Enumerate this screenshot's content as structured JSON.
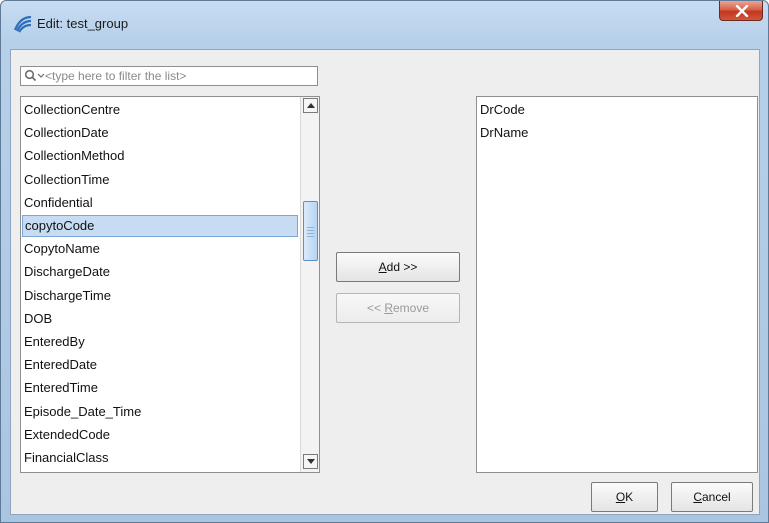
{
  "window": {
    "title": "Edit: test_group"
  },
  "filter": {
    "placeholder": "<type here to filter the list>",
    "value": ""
  },
  "available_list": {
    "items": [
      "CollectionCentre",
      "CollectionDate",
      "CollectionMethod",
      "CollectionTime",
      "Confidential",
      "copytoCode",
      "CopytoName",
      "DischargeDate",
      "DischargeTime",
      "DOB",
      "EnteredBy",
      "EnteredDate",
      "EnteredTime",
      "Episode_Date_Time",
      "ExtendedCode",
      "FinancialClass"
    ],
    "selected": "copytoCode"
  },
  "selected_list": {
    "items": [
      "DrCode",
      "DrName"
    ]
  },
  "buttons": {
    "add": {
      "mnemonic": "A",
      "rest": "dd >>"
    },
    "remove": {
      "prefix": "<< ",
      "mnemonic": "R",
      "rest": "emove"
    },
    "ok": {
      "mnemonic": "O",
      "rest": "K"
    },
    "cancel": {
      "mnemonic": "C",
      "rest": "ancel"
    }
  }
}
